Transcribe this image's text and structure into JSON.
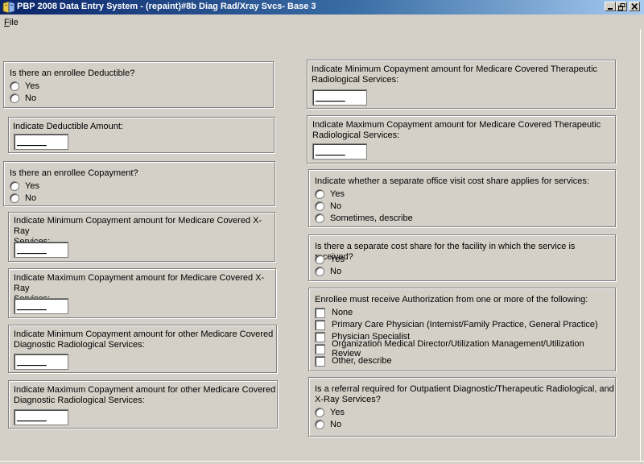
{
  "window": {
    "title": "PBP 2008 Data Entry System - (repaint)#8b Diag Rad/Xray Svcs- Base 3"
  },
  "menu": {
    "file_first": "F",
    "file_rest": "ile"
  },
  "left": {
    "deductible": {
      "question": "Is there an enrollee Deductible?",
      "options": [
        "Yes",
        "No"
      ]
    },
    "deductible_amount": {
      "question": "Indicate Deductible Amount:",
      "value": "______"
    },
    "copayment": {
      "question": "Is there an enrollee Copayment?",
      "options": [
        "Yes",
        "No"
      ]
    },
    "min_xray": {
      "line1": "Indicate Minimum Copayment amount for Medicare Covered X-Ray",
      "line2": "Services:",
      "value": "______"
    },
    "max_xray": {
      "line1": "Indicate Maximum Copayment amount for Medicare Covered X-Ray",
      "line2": "Services:",
      "value": "______"
    },
    "min_diag": {
      "line1": "Indicate Minimum Copayment amount for other Medicare Covered",
      "line2": "Diagnostic Radiological Services:",
      "value": "______"
    },
    "max_diag": {
      "line1": "Indicate Maximum Copayment amount for other Medicare Covered",
      "line2": "Diagnostic Radiological Services:",
      "value": "______"
    }
  },
  "right": {
    "min_thera": {
      "line1": "Indicate Minimum Copayment amount for Medicare Covered Therapeutic",
      "line2": "Radiological Services:",
      "value": "______"
    },
    "max_thera": {
      "line1": "Indicate Maximum Copayment amount for Medicare Covered Therapeutic",
      "line2": "Radiological Services:",
      "value": "______"
    },
    "office_visit": {
      "question": "Indicate whether a separate office visit cost share applies for services:",
      "options": [
        "Yes",
        "No",
        "Sometimes, describe"
      ]
    },
    "facility": {
      "question": "Is there a separate cost share for the facility in which the service is received?",
      "options": [
        "Yes",
        "No"
      ]
    },
    "authorization": {
      "question": "Enrollee must receive Authorization from one or more of the following:",
      "options": [
        "None",
        "Primary Care Physician (Internist/Family Practice, General Practice)",
        "Physician Specialist",
        "Organization Medical Director/Utilization Management/Utilization Review",
        "Other, describe"
      ]
    },
    "referral": {
      "line1": "Is a referral required for Outpatient Diagnostic/Therapeutic Radiological, and",
      "line2": "X-Ray Services?",
      "options": [
        "Yes",
        "No"
      ]
    }
  }
}
